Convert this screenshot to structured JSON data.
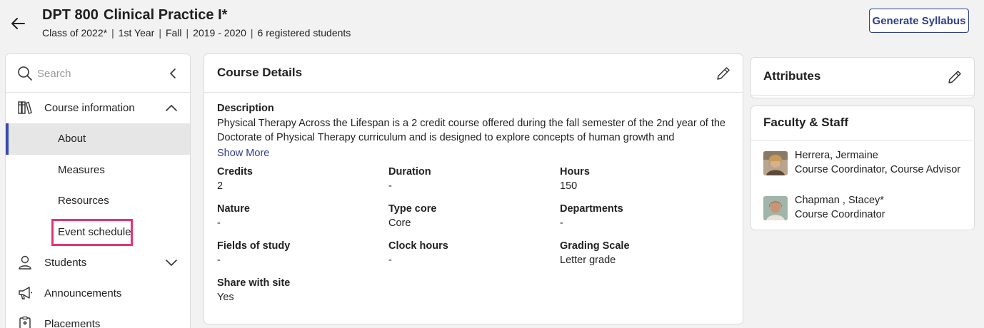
{
  "header": {
    "course_code": "DPT 800",
    "course_title": "Clinical Practice I*",
    "meta": [
      "Class of 2022*",
      "1st Year",
      "Fall",
      "2019 - 2020",
      "6 registered students"
    ],
    "meta_separator": "|",
    "generate_button": "Generate Syllabus"
  },
  "sidebar": {
    "search_placeholder": "Search",
    "items": [
      {
        "label": "Course information",
        "icon": "books-icon",
        "expanded": true
      },
      {
        "label": "Students",
        "icon": "person-icon",
        "expanded": false
      },
      {
        "label": "Announcements",
        "icon": "megaphone-icon"
      },
      {
        "label": "Placements",
        "icon": "clipboard-icon"
      }
    ],
    "sub_items": [
      {
        "label": "About",
        "active": true
      },
      {
        "label": "Measures"
      },
      {
        "label": "Resources"
      },
      {
        "label": "Event schedule",
        "highlighted": true
      }
    ]
  },
  "course_details": {
    "title": "Course Details",
    "description_label": "Description",
    "description": "Physical Therapy Across the Lifespan is a 2 credit course offered during the fall semester of the 2nd year of the Doctorate of Physical Therapy curriculum and is designed to explore concepts of human growth and development across the lifespan.",
    "show_more": "Show More",
    "fields": [
      {
        "label": "Credits",
        "value": "2"
      },
      {
        "label": "Duration",
        "value": "-"
      },
      {
        "label": "Hours",
        "value": "150"
      },
      {
        "label": "Nature",
        "value": "-"
      },
      {
        "label": "Type core",
        "value": "Core"
      },
      {
        "label": "Departments",
        "value": "-"
      },
      {
        "label": "Fields of study",
        "value": "-"
      },
      {
        "label": "Clock hours",
        "value": "-"
      },
      {
        "label": "Grading Scale",
        "value": "Letter grade"
      },
      {
        "label": "Share with site",
        "value": "Yes"
      }
    ]
  },
  "attributes": {
    "title": "Attributes"
  },
  "faculty": {
    "title": "Faculty & Staff",
    "people": [
      {
        "name": "Herrera, Jermaine",
        "role": "Course Coordinator, Course Advisor"
      },
      {
        "name": "Chapman , Stacey*",
        "role": "Course Coordinator"
      }
    ]
  },
  "colors": {
    "accent": "#2c3e8c",
    "active_indicator": "#3b4ab0",
    "highlight": "#e0357a",
    "background": "#f2f2f2"
  }
}
